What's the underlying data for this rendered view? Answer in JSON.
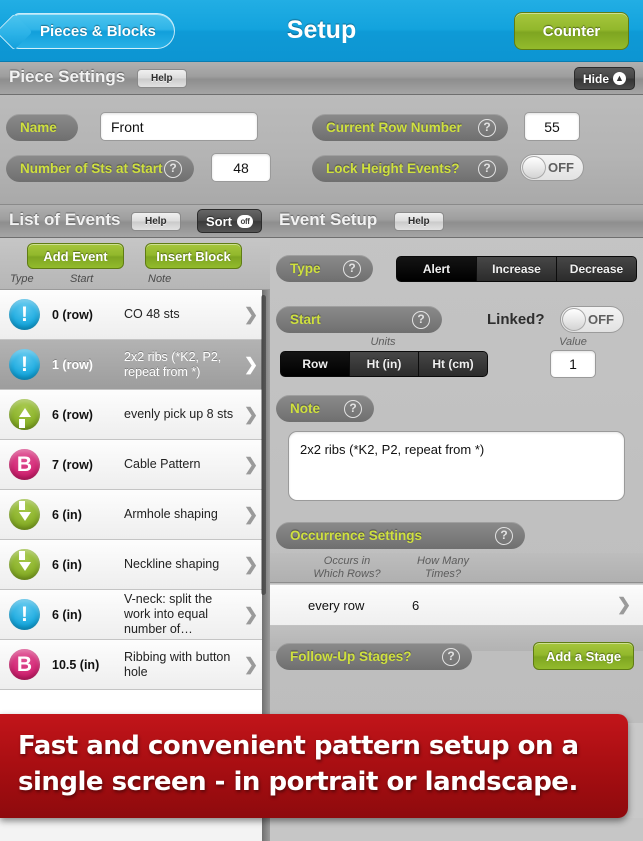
{
  "navbar": {
    "back_label": "Pieces & Blocks",
    "title": "Setup",
    "counter_label": "Counter"
  },
  "piece_settings": {
    "section_title": "Piece Settings",
    "help_label": "Help",
    "hide_label": "Hide",
    "hide_icon": "arrow-up-icon",
    "name_label": "Name",
    "name_value": "Front",
    "sts_label": "Number of Sts at Start",
    "sts_value": "48",
    "current_row_label": "Current Row Number",
    "current_row_value": "55",
    "lock_height_label": "Lock Height Events?",
    "lock_height_state": "OFF",
    "help_icon": "question-mark-icon"
  },
  "events_panel": {
    "section_title": "List of Events",
    "help_label": "Help",
    "sort_label": "Sort",
    "sort_state": "off",
    "add_event_label": "Add Event",
    "insert_block_label": "Insert Block",
    "col_type": "Type",
    "col_start": "Start",
    "col_note": "Note",
    "rows": [
      {
        "icon": "alert-icon",
        "icon_glyph": "!",
        "start": "0 (row)",
        "note": "CO 48 sts",
        "selected": false
      },
      {
        "icon": "alert-icon",
        "icon_glyph": "!",
        "start": "1 (row)",
        "note": "2x2 ribs (*K2, P2, repeat from *)",
        "selected": true
      },
      {
        "icon": "increase-icon",
        "icon_glyph": "",
        "start": "6 (row)",
        "note": "evenly pick up 8 sts",
        "selected": false
      },
      {
        "icon": "block-icon",
        "icon_glyph": "B",
        "start": "7 (row)",
        "note": "Cable Pattern",
        "selected": false
      },
      {
        "icon": "decrease-icon",
        "icon_glyph": "",
        "start": "6 (in)",
        "note": "Armhole shaping",
        "selected": false
      },
      {
        "icon": "decrease-icon",
        "icon_glyph": "",
        "start": "6 (in)",
        "note": "Neckline shaping",
        "selected": false
      },
      {
        "icon": "alert-icon",
        "icon_glyph": "!",
        "start": "6 (in)",
        "note": "V-neck: split the work into equal number of…",
        "selected": false
      },
      {
        "icon": "block-icon",
        "icon_glyph": "B",
        "start": "10.5 (in)",
        "note": "Ribbing with button hole",
        "selected": false
      }
    ],
    "chevron_icon": "chevron-right-icon"
  },
  "event_setup": {
    "section_title": "Event Setup",
    "help_label": "Help",
    "type_label": "Type",
    "type_options": [
      "Alert",
      "Increase",
      "Decrease"
    ],
    "type_selected": "Alert",
    "start_label": "Start",
    "linked_label": "Linked?",
    "linked_state": "OFF",
    "units_label": "Units",
    "units_options": [
      "Row",
      "Ht (in)",
      "Ht (cm)"
    ],
    "units_selected": "Row",
    "value_label": "Value",
    "value": "1",
    "note_label": "Note",
    "note_text": "2x2 ribs (*K2, P2, repeat from *)",
    "occurrence_label": "Occurrence Settings",
    "occ_col1_line1": "Occurs in",
    "occ_col1_line2": "Which Rows?",
    "occ_col2_line1": "How Many",
    "occ_col2_line2": "Times?",
    "occ_value1": "every row",
    "occ_value2": "6",
    "followup_label": "Follow-Up Stages?",
    "add_stage_label": "Add a Stage",
    "help_icon": "question-mark-icon",
    "chevron_icon": "chevron-right-icon"
  },
  "banner": {
    "line1": "Fast and convenient pattern setup on a",
    "line2": "single screen - in portrait or landscape."
  },
  "colors": {
    "nav_blue": "#13a3dd",
    "accent_green": "#92b82c",
    "label_yellow": "#cfe03f",
    "banner_red": "#a80e12",
    "alert_blue": "#12a6dd",
    "block_pink": "#d01e6e"
  }
}
